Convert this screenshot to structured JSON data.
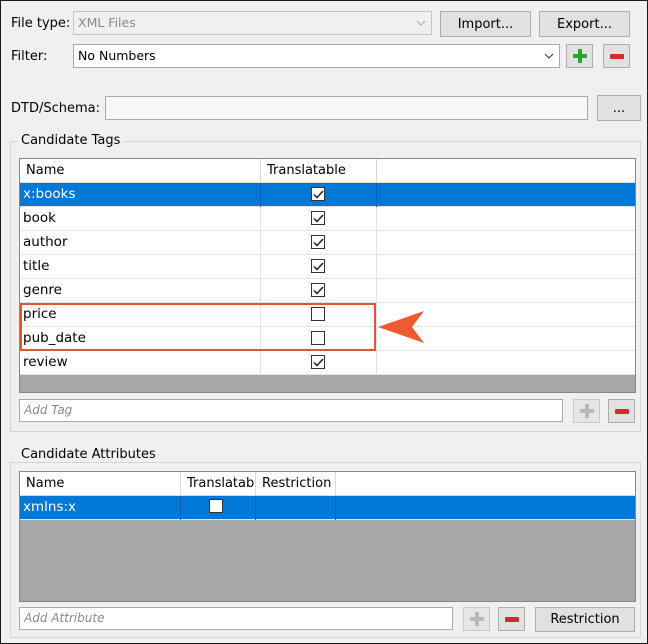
{
  "file_type": {
    "label": "File type:",
    "value": "XML Files",
    "import_label": "Import...",
    "export_label": "Export..."
  },
  "filter": {
    "label": "Filter:",
    "value": "No Numbers"
  },
  "dtd": {
    "label": "DTD/Schema:",
    "value": "",
    "browse_label": "..."
  },
  "candidate_tags": {
    "title": "Candidate Tags",
    "columns": [
      "Name",
      "Translatable"
    ],
    "rows": [
      {
        "name": "x:books",
        "translatable": true,
        "selected": true
      },
      {
        "name": "book",
        "translatable": true,
        "selected": false
      },
      {
        "name": "author",
        "translatable": true,
        "selected": false
      },
      {
        "name": "title",
        "translatable": true,
        "selected": false
      },
      {
        "name": "genre",
        "translatable": true,
        "selected": false
      },
      {
        "name": "price",
        "translatable": false,
        "selected": false
      },
      {
        "name": "pub_date",
        "translatable": false,
        "selected": false
      },
      {
        "name": "review",
        "translatable": true,
        "selected": false
      }
    ],
    "add_placeholder": "Add Tag"
  },
  "candidate_attributes": {
    "title": "Candidate Attributes",
    "columns": [
      "Name",
      "Translatable",
      "Restriction"
    ],
    "rows": [
      {
        "name": "xmlns:x",
        "translatable": false,
        "restriction": "",
        "selected": true
      }
    ],
    "add_placeholder": "Add Attribute",
    "restriction_button": "Restriction"
  },
  "colors": {
    "selection": "#0078d7",
    "highlight": "#e2562e",
    "add_green": "#2aa52a",
    "remove_red": "#d42a2a",
    "grid_empty": "#a7a7a7"
  }
}
